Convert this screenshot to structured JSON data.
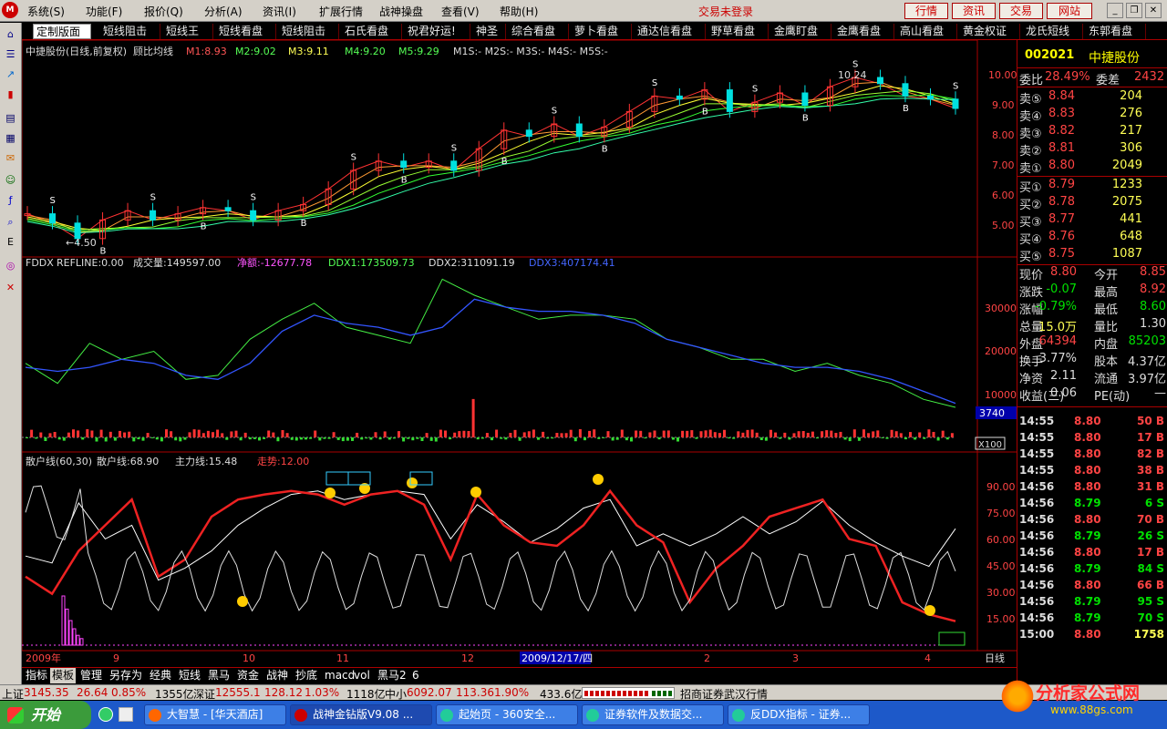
{
  "menu": {
    "items": [
      "系统(S)",
      "功能(F)",
      "报价(Q)",
      "分析(A)",
      "资讯(I)",
      "扩展行情",
      "战神操盘",
      "查看(V)",
      "帮助(H)"
    ],
    "trade_status": "交易未登录",
    "quick_buttons": [
      "行情",
      "资讯",
      "交易",
      "网站"
    ]
  },
  "tabs": [
    "定制版面",
    "短线阻击",
    "短线王",
    "短线看盘",
    "短线阻击",
    "石氏看盘",
    "祝君好运!",
    "神圣",
    "综合看盘",
    "萝卜看盘",
    "通达信看盘",
    "野草看盘",
    "金鹰盯盘",
    "金鹰看盘",
    "高山看盘",
    "黄金权证",
    "龙氏短线",
    "东郭看盘"
  ],
  "chart": {
    "price_header": {
      "title": "中捷股份(日线,前复权)",
      "indicator": "顾比均线",
      "m1": "M1:8.93",
      "m2": "M2:9.02",
      "m3": "M3:9.11",
      "m4": "M4:9.20",
      "m5": "M5:9.29",
      "rest": "M1S:- M2S:- M3S:- M4S:- M5S:-"
    },
    "price_axis": [
      "10.00",
      "9.00",
      "8.00",
      "7.00",
      "6.00",
      "5.00"
    ],
    "low_label": "←4.50",
    "high_label": "10.24",
    "ddx_header": {
      "name": "FDDX",
      "refline": "REFLINE:0.00",
      "vol": "成交量:149597.00",
      "net": "净额:-12677.78",
      "ddx1": "DDX1:173509.73",
      "ddx2": "DDX2:311091.19",
      "ddx3": "DDX3:407174.41"
    },
    "ddx_axis": [
      "30000",
      "20000",
      "10000"
    ],
    "ddx_value_box": "3740",
    "ddx_scale": "X100",
    "sanhu_header": {
      "a": "散户线(60,30)",
      "b": "散户线:68.90",
      "c": "主力线:15.48",
      "d": "走势:12.00"
    },
    "sanhu_axis": [
      "90.00",
      "75.00",
      "60.00",
      "45.00",
      "30.00",
      "15.00"
    ],
    "date_labels": [
      "2009年",
      "9",
      "10",
      "11",
      "12",
      "2",
      "3",
      "4"
    ],
    "cursor_date": "2009/12/17/四",
    "period": "日线"
  },
  "chart_data": [
    {
      "type": "line",
      "title": "中捷股份(日线,前复权) 顾比均线",
      "series": [
        {
          "name": "M1",
          "values": [
            5.5,
            5.2,
            4.7,
            5.3,
            5.6,
            5.3,
            5.5,
            5.7,
            5.6,
            5.3,
            5.6,
            5.8,
            6.3,
            6.9,
            7.2,
            7.0,
            7.2,
            6.9,
            7.6,
            8.2,
            8.0,
            8.4,
            8.0,
            8.3,
            8.8,
            9.3,
            9.2,
            9.5,
            8.8,
            9.1,
            9.4,
            9.0,
            9.6,
            9.9,
            9.7,
            9.3,
            9.2,
            8.9
          ]
        }
      ],
      "ylim": [
        4.4,
        10.4
      ],
      "annotations": [
        "←4.50",
        "10.24"
      ]
    },
    {
      "type": "line",
      "title": "FDDX",
      "series": [
        {
          "name": "DDX1",
          "values": [
            16000,
            11000,
            21000,
            17000,
            19000,
            12000,
            13000,
            22000,
            27000,
            31000,
            25000,
            23000,
            21000,
            37000,
            33000,
            30000,
            27000,
            28000,
            28000,
            27000,
            22000,
            20000,
            17000,
            17000,
            14000,
            16000,
            13000,
            11000,
            7000,
            5000
          ]
        },
        {
          "name": "DDX2",
          "values": [
            15000,
            14000,
            15000,
            17000,
            16000,
            13000,
            12000,
            16000,
            24000,
            28000,
            26000,
            25000,
            23000,
            25000,
            32000,
            30000,
            29000,
            29000,
            28000,
            26000,
            22000,
            20000,
            18000,
            16000,
            15000,
            15000,
            14000,
            12000,
            9000,
            6000
          ]
        }
      ],
      "ylim": [
        0,
        38000
      ],
      "yticks": [
        30000,
        20000,
        10000
      ]
    },
    {
      "type": "line",
      "title": "散户线(60,30)",
      "series": [
        {
          "name": "散户线",
          "values": [
            52,
            48,
            83,
            62,
            70,
            38,
            45,
            55,
            70,
            80,
            88,
            90,
            85,
            88,
            90,
            88,
            62,
            82,
            72,
            60,
            68,
            80,
            85,
            58,
            65,
            58,
            65,
            75,
            65,
            72,
            84,
            70,
            60,
            52,
            46,
            68
          ]
        },
        {
          "name": "主力线",
          "values": [
            40,
            30,
            55,
            70,
            85,
            40,
            50,
            75,
            85,
            88,
            90,
            88,
            82,
            88,
            90,
            82,
            50,
            88,
            70,
            60,
            58,
            70,
            90,
            70,
            60,
            25,
            45,
            58,
            75,
            80,
            85,
            62,
            58,
            25,
            18,
            14
          ]
        }
      ],
      "ylim": [
        0,
        100
      ],
      "yticks": [
        90,
        75,
        60,
        45,
        30,
        15
      ]
    }
  ],
  "quote": {
    "code": "002021",
    "name": "中捷股份",
    "weibi_label": "委比",
    "weibi": "28.49%",
    "weicha_label": "委差",
    "weicha": "2432",
    "asks": [
      {
        "label": "卖⑤",
        "price": "8.84",
        "vol": "204"
      },
      {
        "label": "卖④",
        "price": "8.83",
        "vol": "276"
      },
      {
        "label": "卖③",
        "price": "8.82",
        "vol": "217"
      },
      {
        "label": "卖②",
        "price": "8.81",
        "vol": "306"
      },
      {
        "label": "卖①",
        "price": "8.80",
        "vol": "2049"
      }
    ],
    "bids": [
      {
        "label": "买①",
        "price": "8.79",
        "vol": "1233"
      },
      {
        "label": "买②",
        "price": "8.78",
        "vol": "2075"
      },
      {
        "label": "买③",
        "price": "8.77",
        "vol": "441"
      },
      {
        "label": "买④",
        "price": "8.76",
        "vol": "648"
      },
      {
        "label": "买⑤",
        "price": "8.75",
        "vol": "1087"
      }
    ],
    "stats": [
      {
        "l1": "现价",
        "v1": "8.80",
        "l2": "今开",
        "v2": "8.85"
      },
      {
        "l1": "涨跌",
        "v1": "-0.07",
        "l2": "最高",
        "v2": "8.92"
      },
      {
        "l1": "涨幅",
        "v1": "-0.79%",
        "l2": "最低",
        "v2": "8.60"
      },
      {
        "l1": "总量",
        "v1": "15.0万",
        "l2": "量比",
        "v2": "1.30"
      },
      {
        "l1": "外盘",
        "v1": "64394",
        "l2": "内盘",
        "v2": "85203"
      },
      {
        "l1": "换手",
        "v1": "3.77%",
        "l2": "股本",
        "v2": "4.37亿"
      },
      {
        "l1": "净资",
        "v1": "2.11",
        "l2": "流通",
        "v2": "3.97亿"
      },
      {
        "l1": "收益(三)",
        "v1": "0.06",
        "l2": "PE(动)",
        "v2": "—"
      }
    ],
    "ticks": [
      {
        "t": "14:55",
        "p": "8.80",
        "v": "50 B"
      },
      {
        "t": "14:55",
        "p": "8.80",
        "v": "17 B"
      },
      {
        "t": "14:55",
        "p": "8.80",
        "v": "82 B"
      },
      {
        "t": "14:55",
        "p": "8.80",
        "v": "38 B"
      },
      {
        "t": "14:56",
        "p": "8.80",
        "v": "31 B"
      },
      {
        "t": "14:56",
        "p": "8.79",
        "v": "6 S"
      },
      {
        "t": "14:56",
        "p": "8.80",
        "v": "70 B"
      },
      {
        "t": "14:56",
        "p": "8.79",
        "v": "26 S"
      },
      {
        "t": "14:56",
        "p": "8.80",
        "v": "17 B"
      },
      {
        "t": "14:56",
        "p": "8.79",
        "v": "84 S"
      },
      {
        "t": "14:56",
        "p": "8.80",
        "v": "66 B"
      },
      {
        "t": "14:56",
        "p": "8.79",
        "v": "95 S"
      },
      {
        "t": "14:56",
        "p": "8.79",
        "v": "70 S"
      },
      {
        "t": "15:00",
        "p": "8.80",
        "v": "1758"
      }
    ]
  },
  "bottom_tabs": [
    "指标",
    "模板",
    "管理",
    "另存为",
    "经典",
    "短线",
    "黑马",
    "资金",
    "战神",
    "抄底",
    "macd",
    "vol",
    "黑马2",
    "6"
  ],
  "status": {
    "sh_label": "上证",
    "sh": "3145.35",
    "sh_chg": "26.64",
    "sh_pct": "0.85%",
    "sh_amt": "1355亿",
    "sz_label": "深证",
    "sz": "12555.1",
    "sz_chg": "128.12",
    "sz_pct": "1.03%",
    "sz_amt": "1118亿",
    "zx_label": "中小",
    "zx": "6092.07",
    "zx_chg": "113.36",
    "zx_pct": "1.90%",
    "zx_amt": "433.6亿",
    "broker": "招商证券武汉行情"
  },
  "taskbar": {
    "start": "开始",
    "tasks": [
      "大智慧 - [华天酒店]",
      "战神金钻版V9.08 ...",
      "起始页 - 360安全...",
      "证券软件及数据交...",
      "反DDX指标 - 证券..."
    ]
  },
  "watermark": {
    "name": "分析家公式网",
    "url": "www.88gs.com"
  },
  "colors": {
    "up": "#ff3333",
    "down": "#00e0e0",
    "label_yellow": "#ffff00",
    "border_red": "#a00000"
  }
}
